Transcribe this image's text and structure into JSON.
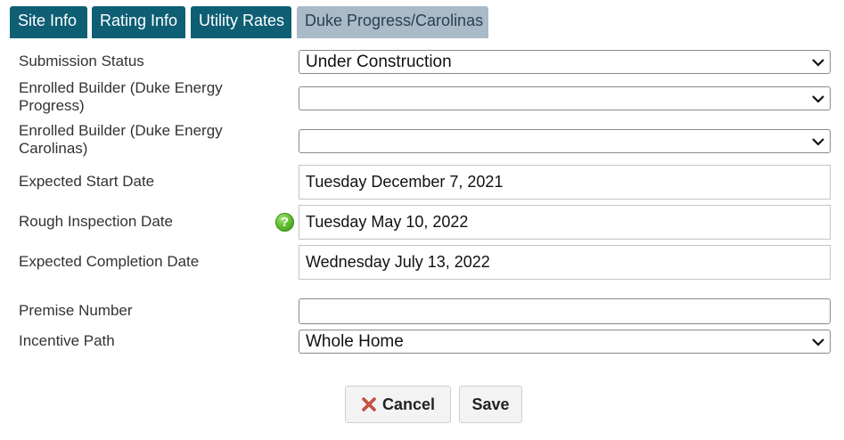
{
  "tabs": [
    {
      "label": "Site Info"
    },
    {
      "label": "Rating Info"
    },
    {
      "label": "Utility Rates"
    },
    {
      "label": "Duke Progress/Carolinas"
    }
  ],
  "active_tab": "Duke Progress/Carolinas",
  "form": {
    "submission_status": {
      "label": "Submission Status",
      "value": "Under Construction"
    },
    "builder_progress": {
      "label": "Enrolled Builder (Duke Energy Progress)",
      "value": ""
    },
    "builder_carolinas": {
      "label": "Enrolled Builder (Duke Energy Carolinas)",
      "value": ""
    },
    "expected_start": {
      "label": "Expected Start Date",
      "value": "Tuesday December 7, 2021"
    },
    "rough_inspection": {
      "label": "Rough Inspection Date",
      "value": "Tuesday May 10, 2022",
      "help_icon": "help-question-icon"
    },
    "expected_completion": {
      "label": "Expected Completion Date",
      "value": "Wednesday July 13, 2022"
    },
    "premise_number": {
      "label": "Premise Number",
      "value": ""
    },
    "incentive_path": {
      "label": "Incentive Path",
      "value": "Whole Home"
    }
  },
  "buttons": {
    "cancel_label": "Cancel",
    "save_label": "Save"
  },
  "colors": {
    "tab_bg": "#0e5e74",
    "active_tab_bg": "#a9bac8",
    "help_icon": "#58b52b",
    "cancel_icon": "#c0392b"
  }
}
